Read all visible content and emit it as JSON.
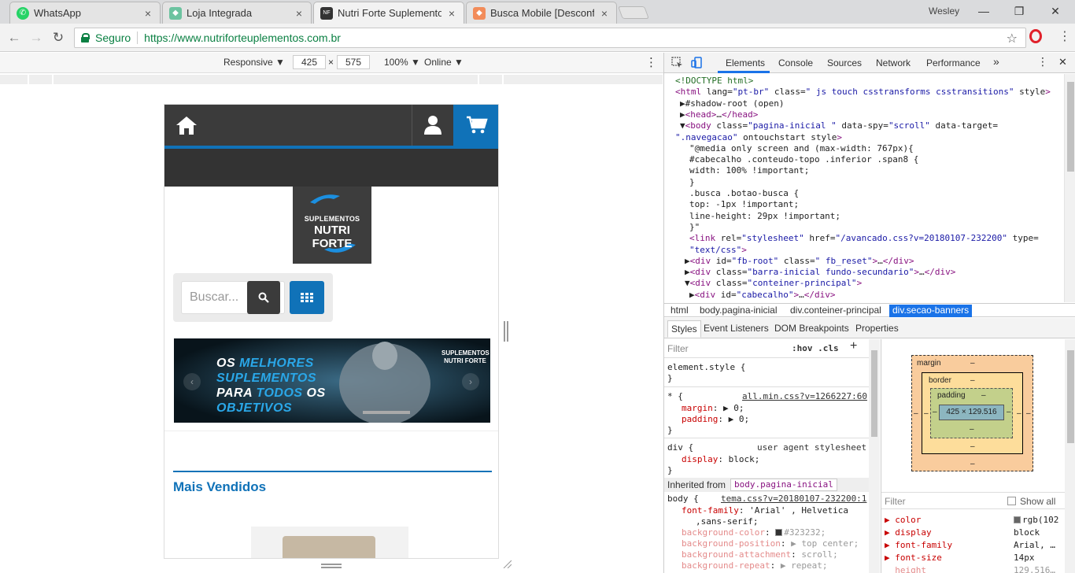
{
  "browser": {
    "tabs": [
      {
        "title": "WhatsApp",
        "close": "×",
        "favicon_color": "#25d366",
        "favicon": "whatsapp-icon"
      },
      {
        "title": "Loja Integrada",
        "close": "×",
        "favicon_color": "#6cc3a0",
        "favicon": "cube-icon"
      },
      {
        "title": "Nutri Forte Suplementos",
        "close": "×",
        "favicon_color": "#333333",
        "favicon": "nutriforte-icon"
      },
      {
        "title": "Busca Mobile [Desconfig",
        "close": "×",
        "favicon_color": "#f28c5a",
        "favicon": "cube-icon"
      }
    ],
    "active_tab": 2,
    "user_name": "Wesley",
    "window_controls": {
      "minimize": "—",
      "restore": "❐",
      "close": "✕"
    },
    "nav": {
      "back": "←",
      "forward": "→",
      "reload": "↻",
      "star": "☆",
      "menu": "⋮"
    },
    "secure_label": "Seguro",
    "url": "https://www.nutriforteuplementos.com.br"
  },
  "device_toolbar": {
    "mode": "Responsive ▼",
    "width": "425",
    "times": "×",
    "height": "575",
    "zoom": "100% ▼",
    "network": "Online ▼",
    "menu": "⋮"
  },
  "site": {
    "logo_line1": "SUPLEMENTOS",
    "logo_line2": "NUTRI FORTE",
    "search_placeholder": "Buscar...",
    "banner": {
      "line1_a": "OS ",
      "line1_b": "MELHORES",
      "line2": "SUPLEMENTOS",
      "line3_a": "PARA ",
      "line3_b": "TODOS",
      "line3_c": " OS",
      "line4": "OBJETIVOS",
      "brand_a": "SUPLEMENTOS",
      "brand_b": "NUTRI FORTE",
      "prev": "‹",
      "next": "›"
    },
    "section_title": "Mais Vendidos",
    "colors": {
      "primary": "#1072b8",
      "header": "#3b3b3b"
    }
  },
  "devtools": {
    "tabs": [
      "Elements",
      "Console",
      "Sources",
      "Network",
      "Performance"
    ],
    "more": "»",
    "menu": "⋮",
    "close": "✕",
    "active_tab": "Elements",
    "dom_lines": [
      {
        "indent": 0,
        "html": "cmt:<!DOCTYPE html>"
      },
      {
        "indent": 0,
        "text": "<html lang=\"pt-br\" class=\" js touch csstransforms csstransitions\" style>"
      },
      {
        "indent": 1,
        "text": "▶#shadow-root (open)"
      },
      {
        "indent": 1,
        "text": "▶<head>…</head>"
      },
      {
        "indent": 1,
        "text": "▼<body class=\"pagina-inicial   \" data-spy=\"scroll\" data-target="
      },
      {
        "indent": 0,
        "text": "\".navegacao\" ontouchstart style>"
      },
      {
        "indent": 3,
        "text": "\"@media only screen and (max-width: 767px){"
      },
      {
        "indent": 3,
        "text": "#cabecalho .conteudo-topo .inferior .span8 {"
      },
      {
        "indent": 3,
        "text": "width: 100% !important;"
      },
      {
        "indent": 3,
        "text": "}"
      },
      {
        "indent": 3,
        "text": ".busca .botao-busca {"
      },
      {
        "indent": 3,
        "text": "top: -1px !important;"
      },
      {
        "indent": 3,
        "text": "line-height: 29px !important;"
      },
      {
        "indent": 3,
        "text": "}\""
      },
      {
        "indent": 3,
        "text": "<link rel=\"stylesheet\" href=\"/avancado.css?v=20180107-232200\" type="
      },
      {
        "indent": 3,
        "text": "\"text/css\">"
      },
      {
        "indent": 2,
        "text": "▶<div id=\"fb-root\" class=\" fb_reset\">…</div>"
      },
      {
        "indent": 2,
        "text": "▶<div class=\"barra-inicial fundo-secundario\">…</div>"
      },
      {
        "indent": 2,
        "text": "▼<div class=\"conteiner-principal\">"
      },
      {
        "indent": 3,
        "text": "▶<div id=\"cabecalho\">…</div>"
      }
    ],
    "breadcrumbs": [
      "html",
      "body.pagina-inicial",
      "div.conteiner-principal",
      "div.secao-banners"
    ],
    "styles_tabs": [
      "Styles",
      "Event Listeners",
      "DOM Breakpoints",
      "Properties"
    ],
    "filter_placeholder": "Filter",
    "hov_cls": ":hov  .cls",
    "add": "+",
    "rules": {
      "element_style": "element.style {",
      "close": "}",
      "star_selector": "* {",
      "star_source": "all.min.css?v=1266227:60",
      "margin_prop": "margin",
      "margin_val": "▶ 0;",
      "padding_prop": "padding",
      "padding_val": "▶ 0;",
      "div_selector": "div {",
      "div_source": "user agent stylesheet",
      "display_prop": "display",
      "display_val": "block;",
      "inherited_label": "Inherited from",
      "inherited_from": "body.pagina-inicial",
      "body_selector": "body {",
      "body_source": "tema.css?v=20180107-232200:1",
      "ff_prop": "font-family",
      "ff_val": "'Arial' , Helvetica",
      "ff_val2": ",sans-serif;",
      "bgc_prop": "background-color",
      "bgc_val": "#323232;",
      "bgp_prop": "background-position",
      "bgp_val": "▶ top center;",
      "bga_prop": "background-attachment",
      "bga_val": "scroll;",
      "bgr_prop": "background-repeat",
      "bgr_val": "▶ repeat;"
    },
    "box_model": {
      "margin": "margin",
      "border": "border",
      "padding": "padding",
      "content": "425 × 129.516",
      "dash": "–"
    },
    "computed": {
      "filter_placeholder": "Filter",
      "show_all": "Show all",
      "rows": [
        {
          "prop": "color",
          "value": "rgb(102"
        },
        {
          "prop": "display",
          "value": "block"
        },
        {
          "prop": "font-family",
          "value": "Arial, …"
        },
        {
          "prop": "font-size",
          "value": "14px"
        },
        {
          "prop": "height",
          "value": "129.516…"
        }
      ]
    }
  }
}
